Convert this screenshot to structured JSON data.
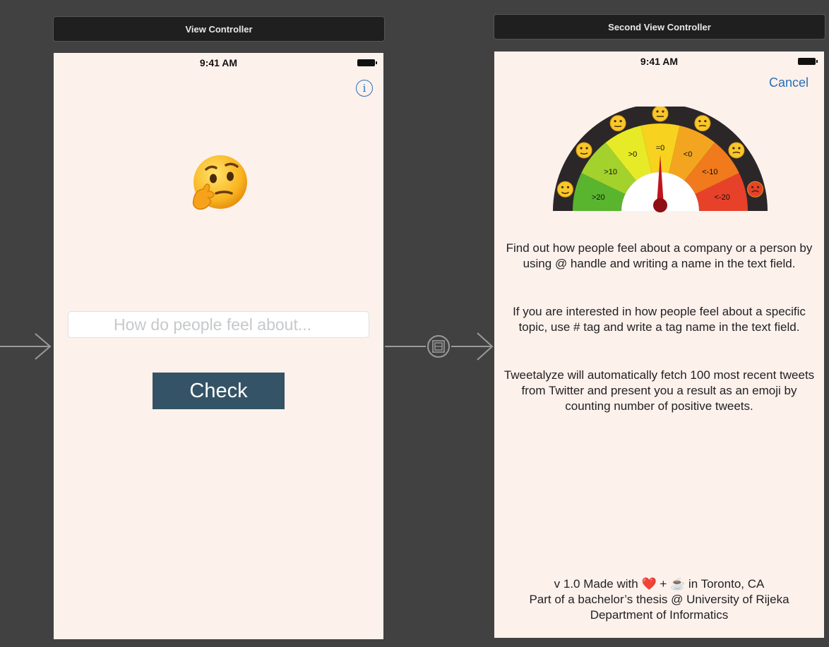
{
  "scene1": {
    "title": "View Controller",
    "status_time": "9:41 AM",
    "info_icon": "info-circle-icon",
    "emoji_icon": "thinking-face-icon",
    "search_placeholder": "How do people feel about...",
    "button_label": "Check",
    "button_color": "#345366",
    "background": "#fdf1ec"
  },
  "scene2": {
    "title": "Second View Controller",
    "status_time": "9:41 AM",
    "cancel_label": "Cancel",
    "gauge": {
      "segments": [
        {
          "label": ">20",
          "color": "#5ab52e"
        },
        {
          "label": ">10",
          "color": "#a3d22c"
        },
        {
          "label": ">0",
          "color": "#e7ea26"
        },
        {
          "label": "=0",
          "color": "#f7d21f"
        },
        {
          "label": "<0",
          "color": "#f4a51f"
        },
        {
          "label": "<-10",
          "color": "#f07a1c"
        },
        {
          "label": "<-20",
          "color": "#e8412a"
        }
      ],
      "ring_emojis": [
        "heart-eyes-icon",
        "grinning-face-icon",
        "smiling-face-icon",
        "neutral-face-icon",
        "frowning-face-icon",
        "steaming-face-icon",
        "angry-face-icon"
      ],
      "needle_color": "#c0141c"
    },
    "paragraphs": [
      "Find out how people feel about a company or a person by using @ handle and writing a name in the text field.",
      "If you are interested in how people feel about a specific topic, use # tag and write a tag name in the text field.",
      "Tweetalyze will automatically fetch 100 most recent tweets from Twitter and present you a result as an emoji by counting number of positive tweets."
    ],
    "footer": {
      "line1_prefix": "v 1.0 Made with",
      "heart": "❤️",
      "plus": "+",
      "coffee": "☕",
      "line1_suffix": "in Toronto, CA",
      "line2": "Part of a bachelor’s thesis @ University of Rijeka",
      "line3": "Department of Informatics"
    }
  },
  "segue": {
    "icon": "segue-modal-icon"
  }
}
